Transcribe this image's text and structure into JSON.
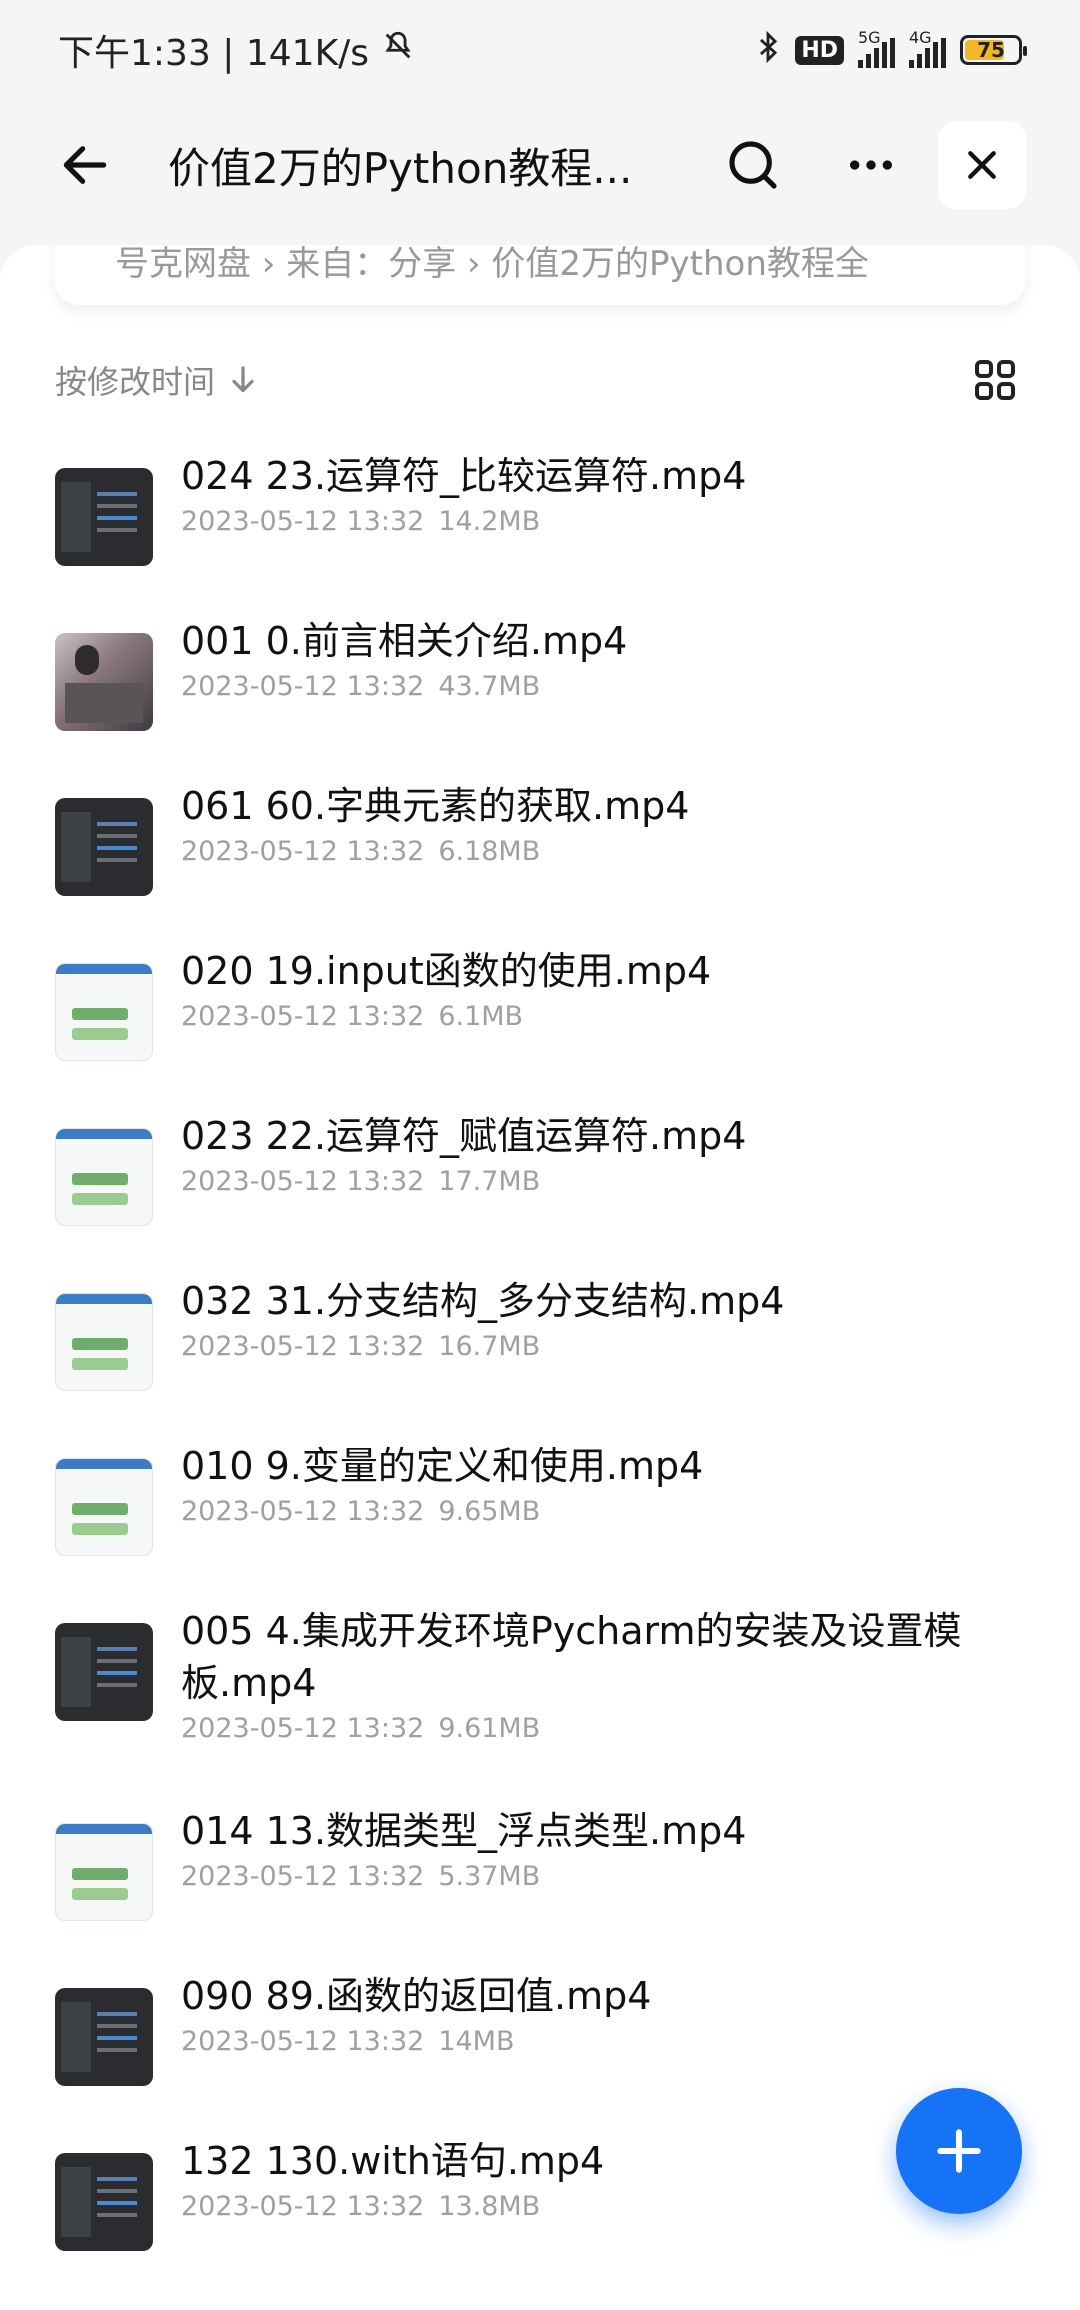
{
  "status_bar": {
    "time": "下午1:33 | 141K/s",
    "hd_badge": "HD",
    "net_5g": "5G",
    "net_4g": "4G",
    "battery": "75"
  },
  "app_bar": {
    "title": "价值2万的Python教程...",
    "icons": [
      "back-arrow-icon",
      "search-icon",
      "more-icon",
      "close-icon"
    ]
  },
  "breadcrumb": "号克网盘 › 来自：分享 › 价值2万的Python教程全",
  "sort": {
    "label": "按修改时间"
  },
  "files": [
    {
      "name": "024 23.运算符_比较运算符.mp4",
      "date": "2023-05-12 13:32",
      "size": "14.2MB",
      "thumb": "dark"
    },
    {
      "name": "001 0.前言相关介绍.mp4",
      "date": "2023-05-12 13:32",
      "size": "43.7MB",
      "thumb": "photo"
    },
    {
      "name": "061 60.字典元素的获取.mp4",
      "date": "2023-05-12 13:32",
      "size": "6.18MB",
      "thumb": "dark"
    },
    {
      "name": "020 19.input函数的使用.mp4",
      "date": "2023-05-12 13:32",
      "size": "6.1MB",
      "thumb": "slide"
    },
    {
      "name": "023 22.运算符_赋值运算符.mp4",
      "date": "2023-05-12 13:32",
      "size": "17.7MB",
      "thumb": "slide"
    },
    {
      "name": "032 31.分支结构_多分支结构.mp4",
      "date": "2023-05-12 13:32",
      "size": "16.7MB",
      "thumb": "slide"
    },
    {
      "name": "010 9.变量的定义和使用.mp4",
      "date": "2023-05-12 13:32",
      "size": "9.65MB",
      "thumb": "slide"
    },
    {
      "name": "005 4.集成开发环境Pycharm的安装及设置模板.mp4",
      "date": "2023-05-12 13:32",
      "size": "9.61MB",
      "thumb": "dark"
    },
    {
      "name": "014 13.数据类型_浮点类型.mp4",
      "date": "2023-05-12 13:32",
      "size": "5.37MB",
      "thumb": "slide"
    },
    {
      "name": "090 89.函数的返回值.mp4",
      "date": "2023-05-12 13:32",
      "size": "14MB",
      "thumb": "dark"
    },
    {
      "name": "132 130.with语句.mp4",
      "date": "2023-05-12 13:32",
      "size": "13.8MB",
      "thumb": "dark"
    }
  ],
  "colors": {
    "accent": "#1773f6",
    "battery": "#f3b629"
  }
}
